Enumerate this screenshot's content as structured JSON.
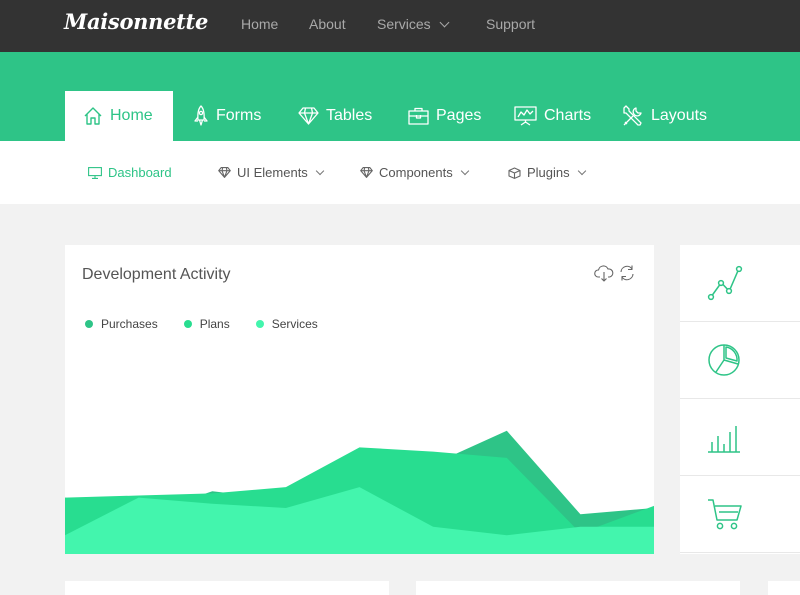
{
  "brand": {
    "logo": "Maisonnette"
  },
  "topnav": [
    {
      "label": "Home"
    },
    {
      "label": "About"
    },
    {
      "label": "Services"
    },
    {
      "label": "Support"
    }
  ],
  "tabs": [
    {
      "label": "Home",
      "icon": "home-icon"
    },
    {
      "label": "Forms",
      "icon": "rocket-icon"
    },
    {
      "label": "Tables",
      "icon": "diamond-icon"
    },
    {
      "label": "Pages",
      "icon": "briefcase-icon"
    },
    {
      "label": "Charts",
      "icon": "presentation-chart-icon"
    },
    {
      "label": "Layouts",
      "icon": "tools-icon"
    }
  ],
  "subnav": [
    {
      "label": "Dashboard",
      "icon": "monitor-icon"
    },
    {
      "label": "UI Elements",
      "icon": "diamond-icon"
    },
    {
      "label": "Components",
      "icon": "diamond-icon"
    },
    {
      "label": "Plugins",
      "icon": "box-icon"
    }
  ],
  "card": {
    "title": "Development Activity",
    "tools": [
      "cloud-download-icon",
      "refresh-icon"
    ]
  },
  "side_tiles": [
    "line-chart-icon",
    "pie-chart-icon",
    "bar-chart-icon",
    "shopping-cart-icon"
  ],
  "colors": {
    "accent": "#2ec487",
    "topbar": "#333333",
    "purchases": "#2ec487",
    "plans": "#28dd90",
    "services": "#43f5ad"
  },
  "chart_data": {
    "type": "area",
    "title": "Development Activity",
    "xlabel": "",
    "ylabel": "",
    "x": [
      0,
      1,
      2,
      3,
      4,
      5,
      6,
      7,
      8
    ],
    "ylim": [
      0,
      100
    ],
    "series": [
      {
        "name": "Purchases",
        "values": [
          27,
          18,
          30,
          26,
          38,
          43,
          59,
          19,
          22
        ]
      },
      {
        "name": "Plans",
        "values": [
          27,
          28,
          29,
          32,
          51,
          49,
          46,
          10,
          23
        ]
      },
      {
        "name": "Services",
        "values": [
          9,
          27,
          24,
          22,
          32,
          13,
          9,
          13,
          13
        ]
      }
    ]
  }
}
